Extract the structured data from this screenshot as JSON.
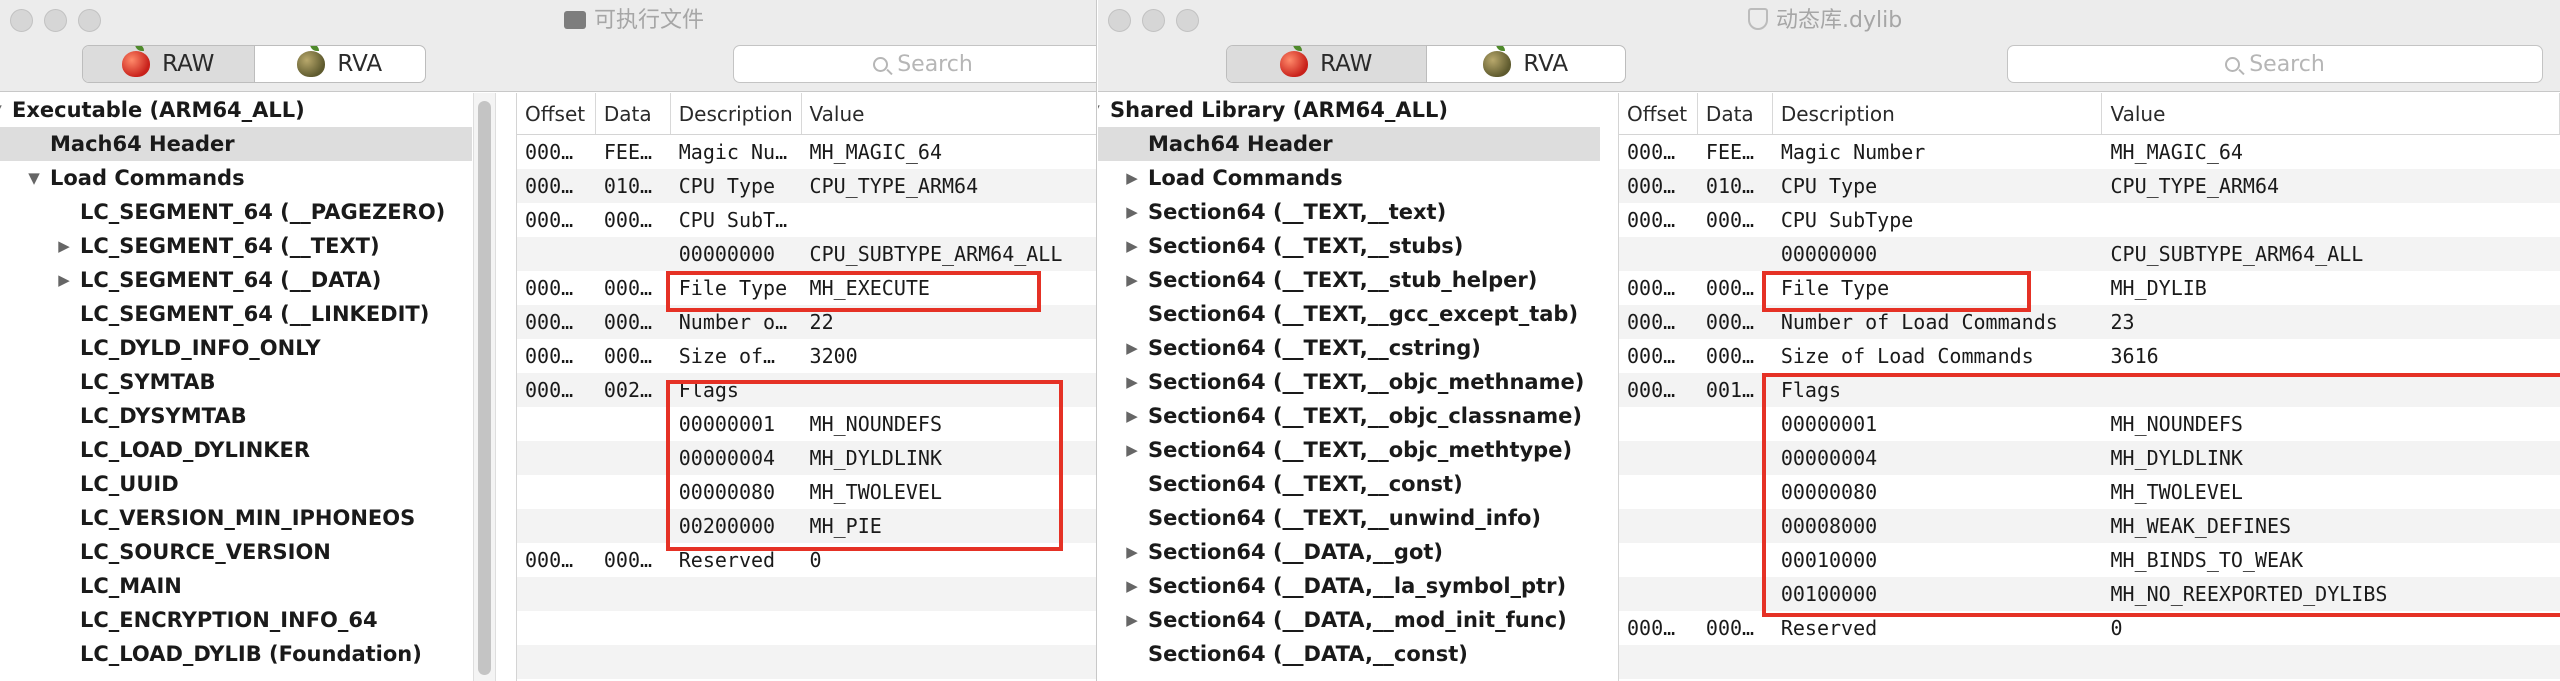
{
  "left_window": {
    "title": "可执行文件",
    "title_icon": "document-icon",
    "segmented": {
      "raw": "RAW",
      "rva": "RVA"
    },
    "search_placeholder": "Search",
    "tree": [
      {
        "label": "Executable (ARM64_ALL)",
        "indent": 0,
        "arrow": "down",
        "selected": false
      },
      {
        "label": "Mach64 Header",
        "indent": 1,
        "arrow": "",
        "selected": true
      },
      {
        "label": "Load Commands",
        "indent": 1,
        "arrow": "down",
        "selected": false
      },
      {
        "label": "LC_SEGMENT_64 (__PAGEZERO)",
        "indent": 2,
        "arrow": "",
        "selected": false
      },
      {
        "label": "LC_SEGMENT_64 (__TEXT)",
        "indent": 2,
        "arrow": "right",
        "selected": false
      },
      {
        "label": "LC_SEGMENT_64 (__DATA)",
        "indent": 2,
        "arrow": "right",
        "selected": false
      },
      {
        "label": "LC_SEGMENT_64 (__LINKEDIT)",
        "indent": 2,
        "arrow": "",
        "selected": false
      },
      {
        "label": "LC_DYLD_INFO_ONLY",
        "indent": 2,
        "arrow": "",
        "selected": false
      },
      {
        "label": "LC_SYMTAB",
        "indent": 2,
        "arrow": "",
        "selected": false
      },
      {
        "label": "LC_DYSYMTAB",
        "indent": 2,
        "arrow": "",
        "selected": false
      },
      {
        "label": "LC_LOAD_DYLINKER",
        "indent": 2,
        "arrow": "",
        "selected": false
      },
      {
        "label": "LC_UUID",
        "indent": 2,
        "arrow": "",
        "selected": false
      },
      {
        "label": "LC_VERSION_MIN_IPHONEOS",
        "indent": 2,
        "arrow": "",
        "selected": false
      },
      {
        "label": "LC_SOURCE_VERSION",
        "indent": 2,
        "arrow": "",
        "selected": false
      },
      {
        "label": "LC_MAIN",
        "indent": 2,
        "arrow": "",
        "selected": false
      },
      {
        "label": "LC_ENCRYPTION_INFO_64",
        "indent": 2,
        "arrow": "",
        "selected": false
      },
      {
        "label": "LC_LOAD_DYLIB (Foundation)",
        "indent": 2,
        "arrow": "",
        "selected": false
      }
    ],
    "columns": [
      "Offset",
      "Data",
      "Description",
      "Value"
    ],
    "rows": [
      [
        "000…",
        "FEE…",
        "Magic Nu…",
        "MH_MAGIC_64"
      ],
      [
        "000…",
        "010…",
        "CPU Type",
        "CPU_TYPE_ARM64"
      ],
      [
        "000…",
        "000…",
        "CPU SubT…",
        ""
      ],
      [
        "",
        "",
        "00000000",
        "CPU_SUBTYPE_ARM64_ALL"
      ],
      [
        "000…",
        "000…",
        "File Type",
        "MH_EXECUTE"
      ],
      [
        "000…",
        "000…",
        "Number o…",
        "22"
      ],
      [
        "000…",
        "000…",
        "Size of…",
        "3200"
      ],
      [
        "000…",
        "002…",
        "Flags",
        ""
      ],
      [
        "",
        "",
        "00000001",
        "MH_NOUNDEFS"
      ],
      [
        "",
        "",
        "00000004",
        "MH_DYLDLINK"
      ],
      [
        "",
        "",
        "00000080",
        "MH_TWOLEVEL"
      ],
      [
        "",
        "",
        "00200000",
        "MH_PIE"
      ],
      [
        "000…",
        "000…",
        "Reserved",
        "0"
      ],
      [
        "",
        "",
        "",
        ""
      ],
      [
        "",
        "",
        "",
        ""
      ],
      [
        "",
        "",
        "",
        ""
      ]
    ]
  },
  "right_window": {
    "title": "动态库.dylib",
    "title_icon": "shield-icon",
    "segmented": {
      "raw": "RAW",
      "rva": "RVA"
    },
    "search_placeholder": "Search",
    "tree": [
      {
        "label": "Shared Library (ARM64_ALL)",
        "indent": 0,
        "arrow": "down",
        "selected": false
      },
      {
        "label": "Mach64 Header",
        "indent": 1,
        "arrow": "",
        "selected": true
      },
      {
        "label": "Load Commands",
        "indent": 1,
        "arrow": "right",
        "selected": false
      },
      {
        "label": "Section64 (__TEXT,__text)",
        "indent": 1,
        "arrow": "right",
        "selected": false
      },
      {
        "label": "Section64 (__TEXT,__stubs)",
        "indent": 1,
        "arrow": "right",
        "selected": false
      },
      {
        "label": "Section64 (__TEXT,__stub_helper)",
        "indent": 1,
        "arrow": "right",
        "selected": false
      },
      {
        "label": "Section64 (__TEXT,__gcc_except_tab)",
        "indent": 1,
        "arrow": "",
        "selected": false
      },
      {
        "label": "Section64 (__TEXT,__cstring)",
        "indent": 1,
        "arrow": "right",
        "selected": false
      },
      {
        "label": "Section64 (__TEXT,__objc_methname)",
        "indent": 1,
        "arrow": "right",
        "selected": false
      },
      {
        "label": "Section64 (__TEXT,__objc_classname)",
        "indent": 1,
        "arrow": "right",
        "selected": false
      },
      {
        "label": "Section64 (__TEXT,__objc_methtype)",
        "indent": 1,
        "arrow": "right",
        "selected": false
      },
      {
        "label": "Section64 (__TEXT,__const)",
        "indent": 1,
        "arrow": "",
        "selected": false
      },
      {
        "label": "Section64 (__TEXT,__unwind_info)",
        "indent": 1,
        "arrow": "",
        "selected": false
      },
      {
        "label": "Section64 (__DATA,__got)",
        "indent": 1,
        "arrow": "right",
        "selected": false
      },
      {
        "label": "Section64 (__DATA,__la_symbol_ptr)",
        "indent": 1,
        "arrow": "right",
        "selected": false
      },
      {
        "label": "Section64 (__DATA,__mod_init_func)",
        "indent": 1,
        "arrow": "right",
        "selected": false
      },
      {
        "label": "Section64 (__DATA,__const)",
        "indent": 1,
        "arrow": "",
        "selected": false
      }
    ],
    "columns": [
      "Offset",
      "Data",
      "Description",
      "Value"
    ],
    "rows": [
      [
        "000…",
        "FEE…",
        "Magic Number",
        "MH_MAGIC_64"
      ],
      [
        "000…",
        "010…",
        "CPU Type",
        "CPU_TYPE_ARM64"
      ],
      [
        "000…",
        "000…",
        "CPU SubType",
        ""
      ],
      [
        "",
        "",
        "00000000",
        "CPU_SUBTYPE_ARM64_ALL"
      ],
      [
        "000…",
        "000…",
        "File Type",
        "MH_DYLIB"
      ],
      [
        "000…",
        "000…",
        "Number of Load Commands",
        "23"
      ],
      [
        "000…",
        "000…",
        "Size of Load Commands",
        "3616"
      ],
      [
        "000…",
        "001…",
        "Flags",
        ""
      ],
      [
        "",
        "",
        "00000001",
        "MH_NOUNDEFS"
      ],
      [
        "",
        "",
        "00000004",
        "MH_DYLDLINK"
      ],
      [
        "",
        "",
        "00000080",
        "MH_TWOLEVEL"
      ],
      [
        "",
        "",
        "00008000",
        "MH_WEAK_DEFINES"
      ],
      [
        "",
        "",
        "00010000",
        "MH_BINDS_TO_WEAK"
      ],
      [
        "",
        "",
        "00100000",
        "MH_NO_REEXPORTED_DYLIBS"
      ],
      [
        "000…",
        "000…",
        "Reserved",
        "0"
      ],
      [
        "",
        "",
        "",
        ""
      ]
    ]
  },
  "highlight_color": "#e53125"
}
